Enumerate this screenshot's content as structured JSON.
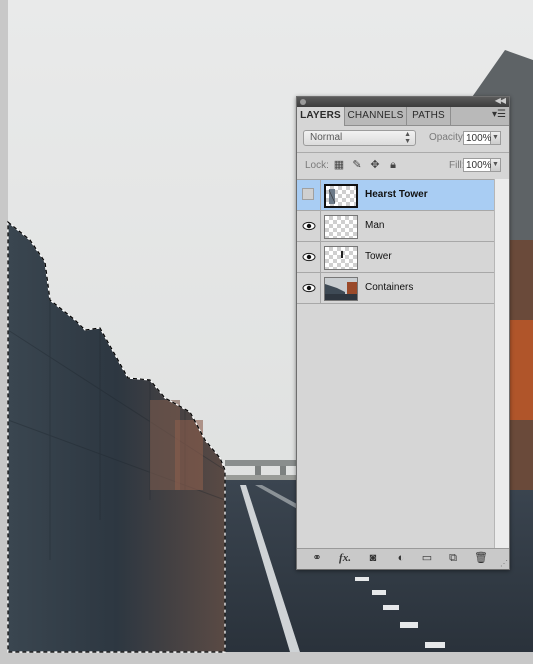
{
  "panel": {
    "tabs": [
      {
        "label": "LAYERS",
        "active": true
      },
      {
        "label": "CHANNELS",
        "active": false
      },
      {
        "label": "PATHS",
        "active": false
      }
    ],
    "blend_mode": "Normal",
    "opacity_label": "Opacity:",
    "opacity_value": "100%",
    "lock_label": "Lock:",
    "fill_label": "Fill:",
    "fill_value": "100%",
    "layers": [
      {
        "name": "Hearst Tower",
        "visible": false,
        "selected": true,
        "thumbnail": "transparent-with-tower-outline"
      },
      {
        "name": "Man",
        "visible": true,
        "selected": false,
        "thumbnail": "transparent"
      },
      {
        "name": "Tower",
        "visible": true,
        "selected": false,
        "thumbnail": "transparent-with-small-figure"
      },
      {
        "name": "Containers",
        "visible": true,
        "selected": false,
        "thumbnail": "container-photo"
      }
    ],
    "bottom_icons": [
      "link-layers-icon",
      "fx-icon",
      "add-mask-icon",
      "adjustment-layer-icon",
      "new-group-folder-icon",
      "new-layer-icon",
      "trash-icon"
    ],
    "colors": {
      "selected_row": "#a9cdf3",
      "panel_bg": "#d6d6d6"
    }
  }
}
